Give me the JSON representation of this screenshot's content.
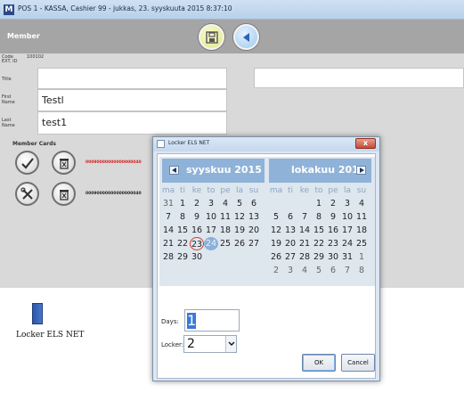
{
  "window": {
    "title": "POS 1 - KASSA, Cashier 99 - jukkas, 23. syyskuuta 2015 8:37:10"
  },
  "header": {
    "title": "Member"
  },
  "member": {
    "code_label": "Code",
    "extid_label": "EXT. ID",
    "code_value": "100102",
    "title_label": "Title",
    "first_name_label": "First Name",
    "first_name_value": "Testl",
    "last_name_label": "Last Name",
    "last_name_value": "test1"
  },
  "cards": {
    "section_label": "Member Cards",
    "rows": [
      {
        "number": "00090000000000000040",
        "color": "#d21f1f"
      },
      {
        "number": "00090000000000000040",
        "color": "#222222"
      }
    ]
  },
  "bottom": {
    "item_label": "Locker ELS NET",
    "icon": "book-icon"
  },
  "dialog": {
    "title": "Locker ELS NET",
    "close_label": "x",
    "calendar": {
      "left_month": "syyskuu 2015",
      "right_month": "lokakuu 2015",
      "weekdays": [
        "ma",
        "ti",
        "ke",
        "to",
        "pe",
        "la",
        "su"
      ],
      "left_weeks": [
        [
          "31",
          "1",
          "2",
          "3",
          "4",
          "5",
          "6"
        ],
        [
          "7",
          "8",
          "9",
          "10",
          "11",
          "12",
          "13"
        ],
        [
          "14",
          "15",
          "16",
          "17",
          "18",
          "19",
          "20"
        ],
        [
          "21",
          "22",
          "23",
          "24",
          "25",
          "26",
          "27"
        ],
        [
          "28",
          "29",
          "30",
          "",
          "",
          "",
          ""
        ]
      ],
      "right_weeks": [
        [
          "",
          "",
          "",
          "1",
          "2",
          "3",
          "4"
        ],
        [
          "5",
          "6",
          "7",
          "8",
          "9",
          "10",
          "11"
        ],
        [
          "12",
          "13",
          "14",
          "15",
          "16",
          "17",
          "18"
        ],
        [
          "19",
          "20",
          "21",
          "22",
          "23",
          "24",
          "25"
        ],
        [
          "26",
          "27",
          "28",
          "29",
          "30",
          "31",
          "1"
        ],
        [
          "2",
          "3",
          "4",
          "5",
          "6",
          "7",
          "8"
        ]
      ],
      "today": "23",
      "selected": "24"
    },
    "days_label": "Days:",
    "days_value": "1",
    "locker_label": "Locker:",
    "locker_value": "2",
    "ok_label": "OK",
    "cancel_label": "Cancel"
  },
  "colors": {
    "header_bg": "#a5a5a5",
    "panel_bg": "#d9d9d9",
    "calendar_header": "#8fb2d8",
    "today_ring": "#d2402a",
    "selected_day": "#8db0da"
  }
}
